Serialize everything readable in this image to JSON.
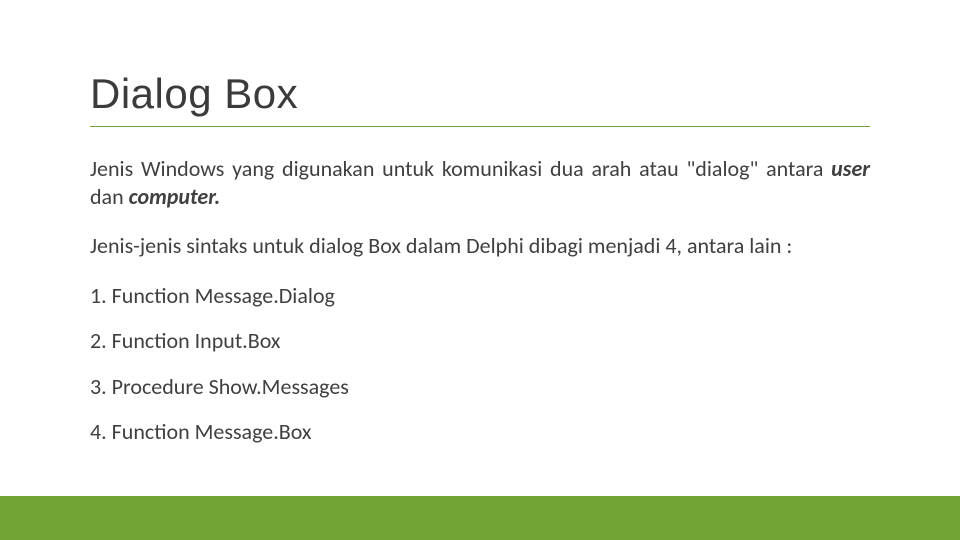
{
  "title": "Dialog Box",
  "intro": {
    "part1": "Jenis Windows yang digunakan untuk komunikasi dua arah atau \"dialog\" antara ",
    "user": "user",
    "dan": " dan ",
    "computer": "computer."
  },
  "subhead": "Jenis-jenis sintaks untuk dialog Box dalam Delphi dibagi menjadi 4, antara lain :",
  "items": [
    "1. Function Message.Dialog",
    "2. Function Input.Box",
    "3. Procedure Show.Messages",
    "4. Function Message.Box"
  ],
  "colors": {
    "accent": "#6fa334"
  }
}
